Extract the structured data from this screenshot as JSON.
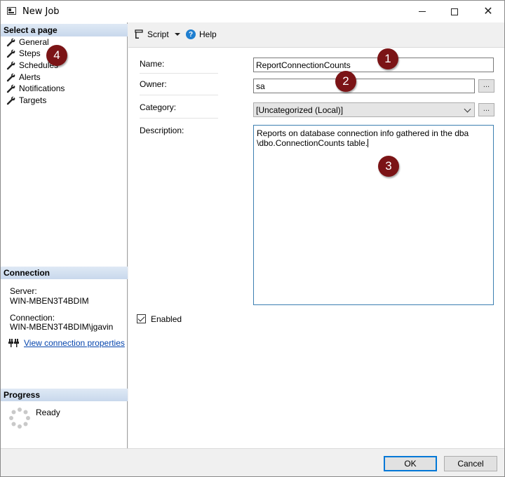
{
  "window": {
    "title": "New Job",
    "close_glyph": "✕"
  },
  "left": {
    "select_page_header": "Select a page",
    "pages": [
      "General",
      "Steps",
      "Schedules",
      "Alerts",
      "Notifications",
      "Targets"
    ],
    "connection_header": "Connection",
    "server_label": "Server:",
    "server_value": "WIN-MBEN3T4BDIM",
    "connection_label": "Connection:",
    "connection_value": "WIN-MBEN3T4BDIM\\jgavin",
    "view_connection_link": "View connection properties",
    "progress_header": "Progress",
    "progress_status": "Ready"
  },
  "toolbar": {
    "script_label": "Script",
    "help_label": "Help",
    "help_glyph": "?"
  },
  "form": {
    "name_label": "Name:",
    "name_value": "ReportConnectionCounts",
    "owner_label": "Owner:",
    "owner_value": "sa",
    "category_label": "Category:",
    "category_value": "[Uncategorized (Local)]",
    "description_label": "Description:",
    "description_value": "Reports on database connection info gathered in the dba \\dbo.ConnectionCounts table.",
    "browse_glyph": "...",
    "enabled_label": "Enabled",
    "enabled": true
  },
  "buttons": {
    "ok": "OK",
    "cancel": "Cancel"
  },
  "callouts": [
    "1",
    "2",
    "3",
    "4"
  ],
  "colors": {
    "callout": "#7b1416",
    "link": "#0645ad",
    "default_button_border": "#0078d7",
    "focus_border": "#3c7fb1"
  }
}
